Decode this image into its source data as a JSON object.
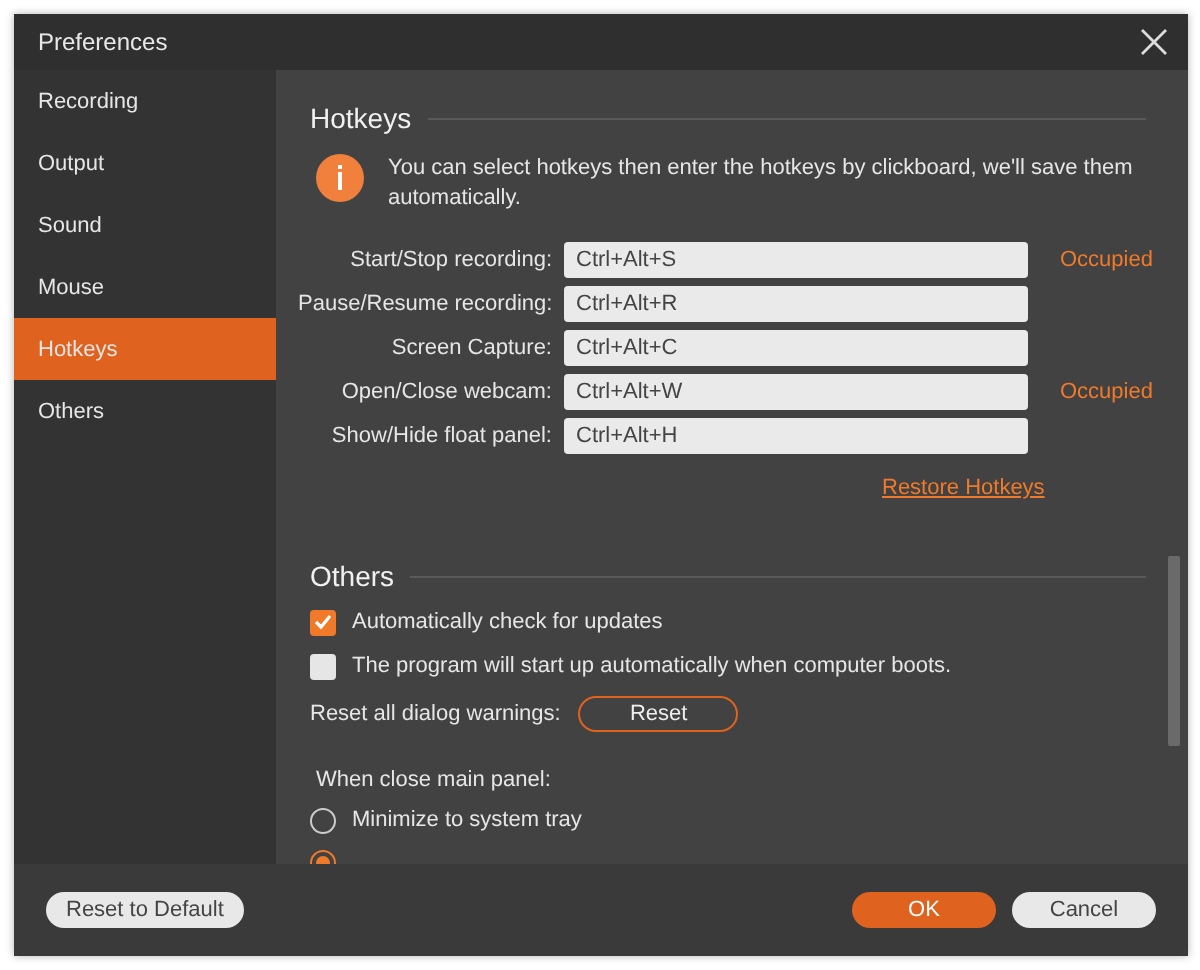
{
  "window": {
    "title": "Preferences"
  },
  "sidebar": {
    "items": [
      {
        "label": "Recording",
        "selected": false
      },
      {
        "label": "Output",
        "selected": false
      },
      {
        "label": "Sound",
        "selected": false
      },
      {
        "label": "Mouse",
        "selected": false
      },
      {
        "label": "Hotkeys",
        "selected": true
      },
      {
        "label": "Others",
        "selected": false
      }
    ]
  },
  "hotkeys": {
    "title": "Hotkeys",
    "info": "You can select hotkeys then enter the hotkeys by clickboard, we'll save them automatically.",
    "rows": [
      {
        "label": "Start/Stop recording:",
        "value": "Ctrl+Alt+S",
        "status": "Occupied"
      },
      {
        "label": "Pause/Resume recording:",
        "value": "Ctrl+Alt+R"
      },
      {
        "label": "Screen Capture:",
        "value": "Ctrl+Alt+C"
      },
      {
        "label": "Open/Close webcam:",
        "value": "Ctrl+Alt+W",
        "status": "Occupied"
      },
      {
        "label": "Show/Hide float panel:",
        "value": "Ctrl+Alt+H"
      }
    ],
    "restore_link": "Restore Hotkeys"
  },
  "others": {
    "title": "Others",
    "checkboxes": [
      {
        "label": "Automatically check for updates",
        "checked": true
      },
      {
        "label": "The program will start up automatically when computer boots.",
        "checked": false
      }
    ],
    "reset_label": "Reset all dialog warnings:",
    "reset_button": "Reset",
    "close_label": "When close main panel:",
    "radios": [
      {
        "label": "Minimize to system tray",
        "selected": false
      },
      {
        "selected": true
      }
    ]
  },
  "footer": {
    "reset_default": "Reset to Default",
    "ok": "OK",
    "cancel": "Cancel"
  }
}
